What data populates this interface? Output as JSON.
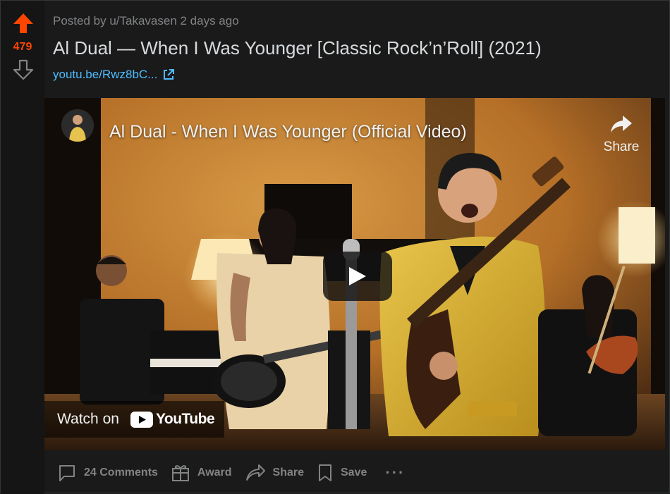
{
  "post": {
    "score": "479",
    "meta": "Posted by u/Takavasen 2 days ago",
    "title": "Al Dual — When I Was Younger [Classic Rock’n’Roll] (2021)",
    "link_text": "youtu.be/Rwz8bC...",
    "link_icon": "external-link-icon"
  },
  "video": {
    "title": "Al Dual - When I Was Younger (Official Video)",
    "share_label": "Share",
    "watch_on_label": "Watch on",
    "youtube_label": "YouTube",
    "play_icon": "play-icon"
  },
  "actions": {
    "comments": "24 Comments",
    "award": "Award",
    "share": "Share",
    "save": "Save",
    "more": "···"
  },
  "colors": {
    "upvote": "#ff4500",
    "link": "#4fbcff",
    "background": "#1a1a1b",
    "muted": "#818384"
  }
}
